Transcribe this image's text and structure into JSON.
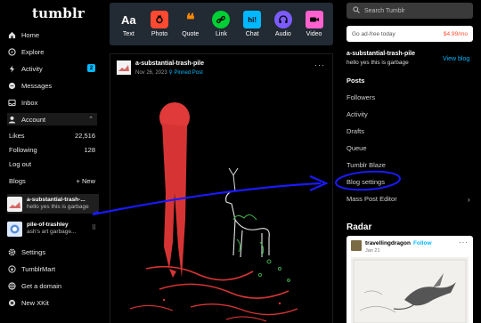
{
  "sidebar": {
    "logo": "tumblr",
    "nav": [
      {
        "label": "Home",
        "icon": "home-icon"
      },
      {
        "label": "Explore",
        "icon": "compass-icon"
      },
      {
        "label": "Activity",
        "icon": "bolt-icon",
        "badge": "2"
      },
      {
        "label": "Messages",
        "icon": "chat-icon"
      },
      {
        "label": "Inbox",
        "icon": "inbox-icon"
      },
      {
        "label": "Account",
        "icon": "person-icon"
      }
    ],
    "stats": [
      {
        "label": "Likes",
        "value": "22,516"
      },
      {
        "label": "Following",
        "value": "128"
      }
    ],
    "logout": "Log out",
    "blogs_label": "Blogs",
    "new_label": "+ New",
    "blogs": [
      {
        "name": "a-substantial-trash-...",
        "desc": "hello yes this is garbage"
      },
      {
        "name": "pile-of-trashley",
        "desc": "ash's art garbage..."
      }
    ],
    "bottom": [
      {
        "label": "Settings",
        "icon": "gear-icon"
      },
      {
        "label": "TumblrMart",
        "icon": "shop-icon"
      },
      {
        "label": "Get a domain",
        "icon": "globe-icon"
      },
      {
        "label": "New XKit",
        "icon": "xkit-icon"
      }
    ]
  },
  "composer": [
    {
      "label": "Text",
      "glyph": "Aa",
      "color": "#ffffff"
    },
    {
      "label": "Photo",
      "glyph": "",
      "color": "#ff4930"
    },
    {
      "label": "Quote",
      "glyph": "❝",
      "color": "#ff8a00"
    },
    {
      "label": "Link",
      "glyph": "",
      "color": "#00cf35"
    },
    {
      "label": "Chat",
      "glyph": "hi!",
      "color": "#00b8ff"
    },
    {
      "label": "Audio",
      "glyph": "",
      "color": "#7c5cff"
    },
    {
      "label": "Video",
      "glyph": "",
      "color": "#ff62ce"
    }
  ],
  "post": {
    "author": "a-substantial-trash-pile",
    "date": "Nov 26, 2023",
    "pinned": "Pinned Post",
    "more": "···"
  },
  "right": {
    "search_placeholder": "Search Tumblr",
    "adfree_label": "Go ad-free today",
    "adfree_price": "$4.99/mo",
    "blog_name": "a-substantial-trash-pile",
    "blog_desc": "hello yes this is garbage",
    "view_blog": "View blog",
    "menu": [
      "Posts",
      "Followers",
      "Activity",
      "Drafts",
      "Queue",
      "Tumblr Blaze",
      "Blog settings",
      "Mass Post Editor"
    ],
    "radar_title": "Radar",
    "radar_name": "travellingdragon",
    "radar_follow": "Follow",
    "radar_date": "Jan 21"
  },
  "colors": {
    "accent": "#00b8ff",
    "annotation": "#1a1aff",
    "post_red": "#e03a3a"
  }
}
